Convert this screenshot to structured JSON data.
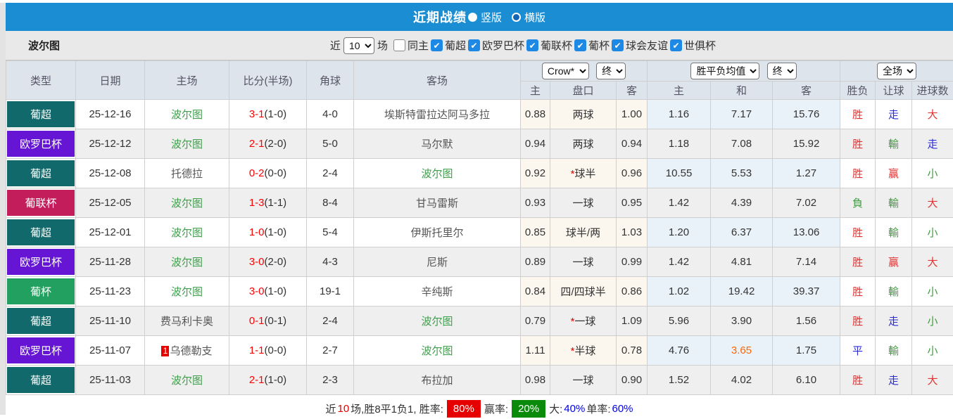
{
  "title_bar": {
    "title": "近期战绩",
    "radio_vertical": "竖版",
    "radio_horizontal": "横版"
  },
  "filter_bar": {
    "team": "波尔图",
    "recent_label": "近",
    "recent_value": "10",
    "matches_label": "场",
    "same_home_label": "同主",
    "leagues": [
      "葡超",
      "欧罗巴杯",
      "葡联杯",
      "葡杯",
      "球会友谊",
      "世俱杯"
    ]
  },
  "table": {
    "headers": {
      "type": "类型",
      "date": "日期",
      "home": "主场",
      "score": "比分(半场)",
      "corners": "角球",
      "away": "客场",
      "asia_home": "主",
      "asia_line": "盘口",
      "asia_away": "客",
      "euro_home": "主",
      "euro_draw": "和",
      "euro_away": "客",
      "result": "胜负",
      "handicap": "让球",
      "goals": "进球数"
    },
    "selects": {
      "company": "Crow*",
      "asia_time": "终",
      "euro_label": "胜平负均值",
      "euro_time": "终",
      "scope": "全场"
    },
    "type_colors": {
      "葡超": "#11696b",
      "欧罗巴杯": "#6615d4",
      "葡联杯": "#c41d5b",
      "葡杯": "#21a05f"
    },
    "value_colors": {
      "胜": "#e03333",
      "負": "#3f9c3f",
      "平": "#2b2bd5",
      "赢": "#e03333",
      "輸": "#3f9c3f",
      "走": "#2b2bd5",
      "大": "#e03333",
      "小": "#3f9c3f"
    },
    "rows": [
      {
        "type": "葡超",
        "date": "25-12-16",
        "home": "波尔图",
        "home_active": true,
        "score": "3-1",
        "half": "(1-0)",
        "corners": "4-0",
        "away": "埃斯特雷拉达阿马多拉",
        "away_active": false,
        "asia_home": "0.88",
        "asia_line": "两球",
        "asia_away": "1.00",
        "euro_home": "1.16",
        "euro_draw": "7.17",
        "euro_away": "15.76",
        "result": "胜",
        "handicap_result": "走",
        "goals_result": "大"
      },
      {
        "type": "欧罗巴杯",
        "date": "25-12-12",
        "home": "波尔图",
        "home_active": true,
        "score": "2-1",
        "half": "(2-0)",
        "corners": "5-0",
        "away": "马尔默",
        "away_active": false,
        "asia_home": "0.94",
        "asia_line": "两球",
        "asia_away": "0.94",
        "euro_home": "1.18",
        "euro_draw": "7.08",
        "euro_away": "15.92",
        "result": "胜",
        "handicap_result": "輸",
        "goals_result": "走"
      },
      {
        "type": "葡超",
        "date": "25-12-08",
        "home": "托德拉",
        "home_active": false,
        "score": "0-2",
        "half": "(0-0)",
        "corners": "2-4",
        "away": "波尔图",
        "away_active": true,
        "asia_home": "0.92",
        "asia_line": "*球半",
        "asia_away": "0.96",
        "euro_home": "10.55",
        "euro_draw": "5.53",
        "euro_away": "1.27",
        "result": "胜",
        "handicap_result": "赢",
        "goals_result": "小"
      },
      {
        "type": "葡联杯",
        "date": "25-12-05",
        "home": "波尔图",
        "home_active": true,
        "score": "1-3",
        "half": "(1-1)",
        "corners": "8-4",
        "away": "甘马雷斯",
        "away_active": false,
        "asia_home": "0.93",
        "asia_line": "一球",
        "asia_away": "0.95",
        "euro_home": "1.42",
        "euro_draw": "4.39",
        "euro_away": "7.02",
        "result": "負",
        "handicap_result": "輸",
        "goals_result": "大"
      },
      {
        "type": "葡超",
        "date": "25-12-01",
        "home": "波尔图",
        "home_active": true,
        "score": "1-0",
        "half": "(1-0)",
        "corners": "5-4",
        "away": "伊斯托里尔",
        "away_active": false,
        "asia_home": "0.85",
        "asia_line": "球半/两",
        "asia_away": "1.03",
        "euro_home": "1.20",
        "euro_draw": "6.37",
        "euro_away": "13.06",
        "result": "胜",
        "handicap_result": "輸",
        "goals_result": "小"
      },
      {
        "type": "欧罗巴杯",
        "date": "25-11-28",
        "home": "波尔图",
        "home_active": true,
        "score": "3-0",
        "half": "(2-0)",
        "corners": "4-3",
        "away": "尼斯",
        "away_active": false,
        "asia_home": "0.89",
        "asia_line": "一球",
        "asia_away": "0.99",
        "euro_home": "1.42",
        "euro_draw": "4.81",
        "euro_away": "7.14",
        "result": "胜",
        "handicap_result": "赢",
        "goals_result": "大"
      },
      {
        "type": "葡杯",
        "date": "25-11-23",
        "home": "波尔图",
        "home_active": true,
        "score": "3-0",
        "half": "(1-0)",
        "corners": "19-1",
        "away": "辛纯斯",
        "away_active": false,
        "asia_home": "0.84",
        "asia_line": "四/四球半",
        "asia_away": "0.86",
        "euro_home": "1.02",
        "euro_draw": "19.42",
        "euro_away": "39.37",
        "result": "胜",
        "handicap_result": "輸",
        "goals_result": "小"
      },
      {
        "type": "葡超",
        "date": "25-11-10",
        "home": "费马利卡奥",
        "home_active": false,
        "score": "0-1",
        "half": "(0-1)",
        "corners": "2-4",
        "away": "波尔图",
        "away_active": true,
        "asia_home": "0.79",
        "asia_line": "*一球",
        "asia_away": "1.09",
        "euro_home": "5.96",
        "euro_draw": "3.90",
        "euro_away": "1.56",
        "result": "胜",
        "handicap_result": "走",
        "goals_result": "小"
      },
      {
        "type": "欧罗巴杯",
        "date": "25-11-07",
        "home": "乌德勒支",
        "home_rank": "1",
        "home_active": false,
        "score": "1-1",
        "half": "(0-0)",
        "corners": "2-7",
        "away": "波尔图",
        "away_active": true,
        "asia_home": "1.11",
        "asia_line": "*半球",
        "asia_away": "0.78",
        "euro_home": "4.76",
        "euro_draw": "3.65",
        "euro_draw_hot": true,
        "euro_away": "1.75",
        "result": "平",
        "handicap_result": "輸",
        "goals_result": "小"
      },
      {
        "type": "葡超",
        "date": "25-11-03",
        "home": "波尔图",
        "home_active": true,
        "score": "2-1",
        "half": "(1-0)",
        "corners": "2-3",
        "away": "布拉加",
        "away_active": false,
        "asia_home": "0.98",
        "asia_line": "一球",
        "asia_away": "0.90",
        "euro_home": "1.52",
        "euro_draw": "4.02",
        "euro_away": "6.10",
        "result": "胜",
        "handicap_result": "走",
        "goals_result": "大"
      }
    ]
  },
  "summary": {
    "segments": [
      {
        "text": "近",
        "style": "plain"
      },
      {
        "text": "10",
        "style": "red"
      },
      {
        "text": "场,胜8平1负1, 胜率:",
        "style": "plain"
      },
      {
        "text": "80%",
        "style": "badge-red"
      },
      {
        "text": "赢率:",
        "style": "plain"
      },
      {
        "text": "20%",
        "style": "badge-green"
      },
      {
        "text": "大:",
        "style": "plain"
      },
      {
        "text": "40%",
        "style": "blue"
      },
      {
        "text": " 单率:",
        "style": "plain"
      },
      {
        "text": "60%",
        "style": "blue"
      }
    ]
  },
  "colors": {
    "accent_blue": "#1b8ed3",
    "checkbox_blue": "#1e88e5",
    "score_red": "#ff0000",
    "team_green": "#3f9e4c",
    "hot_orange": "#ff6600"
  }
}
